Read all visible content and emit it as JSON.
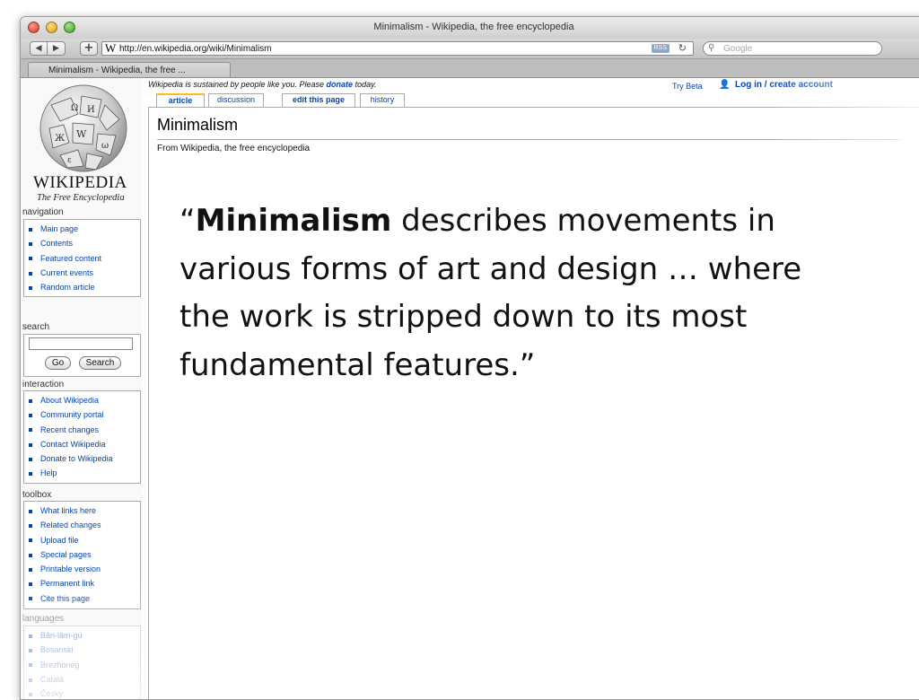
{
  "window": {
    "title": "Minimalism - Wikipedia, the free encyclopedia"
  },
  "toolbar": {
    "back_glyph": "◀",
    "forward_glyph": "▶",
    "add_glyph": "+",
    "url": "http://en.wikipedia.org/wiki/Minimalism",
    "rss_label": "RSS",
    "reload_glyph": "↻",
    "search_placeholder": "Google"
  },
  "tabs": [
    {
      "label": "Minimalism - Wikipedia, the free ..."
    }
  ],
  "logo": {
    "wordmark": "WIKIPEDIA",
    "motto": "The Free Encyclopedia"
  },
  "header": {
    "sustain_before": "Wikipedia is sustained by people like you. Please ",
    "sustain_link": "donate",
    "sustain_after": " today.",
    "try_beta": "Try Beta",
    "login": "Log in / create account"
  },
  "page_tabs": {
    "article": "article",
    "discussion": "discussion",
    "edit": "edit this page",
    "history": "history"
  },
  "article": {
    "title": "Minimalism",
    "subtitle": "From Wikipedia, the free encyclopedia",
    "quote_open": "“",
    "quote_term": "Minimalism",
    "quote_rest": " describes movements in various forms of art and design … where the work is stripped down to its most fundamental features.”"
  },
  "sidebar": {
    "navigation": {
      "heading": "navigation",
      "items": [
        "Main page",
        "Contents",
        "Featured content",
        "Current events",
        "Random article"
      ]
    },
    "search": {
      "heading": "search",
      "go": "Go",
      "search": "Search"
    },
    "interaction": {
      "heading": "interaction",
      "items": [
        "About Wikipedia",
        "Community portal",
        "Recent changes",
        "Contact Wikipedia",
        "Donate to Wikipedia",
        "Help"
      ]
    },
    "toolbox": {
      "heading": "toolbox",
      "items": [
        "What links here",
        "Related changes",
        "Upload file",
        "Special pages",
        "Printable version",
        "Permanent link",
        "Cite this page"
      ]
    },
    "languages": {
      "heading": "languages",
      "items": [
        "Bân-lâm-gú",
        "Bosanski",
        "Brezhoneg",
        "Català",
        "Česky"
      ]
    }
  },
  "colors": {
    "link": "#0645ad",
    "tab_accent": "#fabd23",
    "border": "#aaaaaa"
  }
}
